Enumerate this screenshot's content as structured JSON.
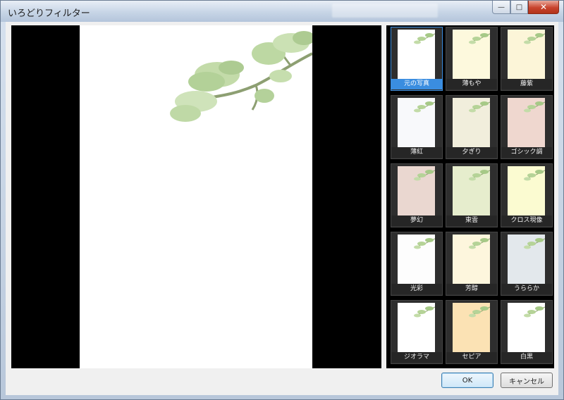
{
  "window": {
    "title": "いろどりフィルター"
  },
  "caption": {
    "minimize": "—",
    "maximize": "□",
    "close": "✕"
  },
  "preview": {
    "icon": "pine-branch-illustration"
  },
  "filters": [
    {
      "label": "元の写真",
      "bg": "#ffffff",
      "selected": true
    },
    {
      "label": "薄もや",
      "bg": "#fdf9dd",
      "selected": false
    },
    {
      "label": "藤紫",
      "bg": "#fcf5d8",
      "selected": false
    },
    {
      "label": "薄紅",
      "bg": "#f8f9fb",
      "selected": false
    },
    {
      "label": "夕ぎり",
      "bg": "#f1eedc",
      "selected": false
    },
    {
      "label": "ゴシック調",
      "bg": "#efd7cf",
      "selected": false
    },
    {
      "label": "夢幻",
      "bg": "#ead7d0",
      "selected": false
    },
    {
      "label": "東雲",
      "bg": "#e6edcd",
      "selected": false
    },
    {
      "label": "クロス現像",
      "bg": "#fbfbd1",
      "selected": false
    },
    {
      "label": "光彩",
      "bg": "#fdfdfd",
      "selected": false
    },
    {
      "label": "芳醇",
      "bg": "#fdf6dd",
      "selected": false
    },
    {
      "label": "うららか",
      "bg": "#e3e8ec",
      "selected": false
    },
    {
      "label": "ジオラマ",
      "bg": "#ffffff",
      "selected": false
    },
    {
      "label": "セピア",
      "bg": "#fbe2b4",
      "selected": false
    },
    {
      "label": "白黒",
      "bg": "#ffffff",
      "selected": false
    }
  ],
  "buttons": {
    "ok": "OK",
    "cancel": "キャンセル"
  }
}
